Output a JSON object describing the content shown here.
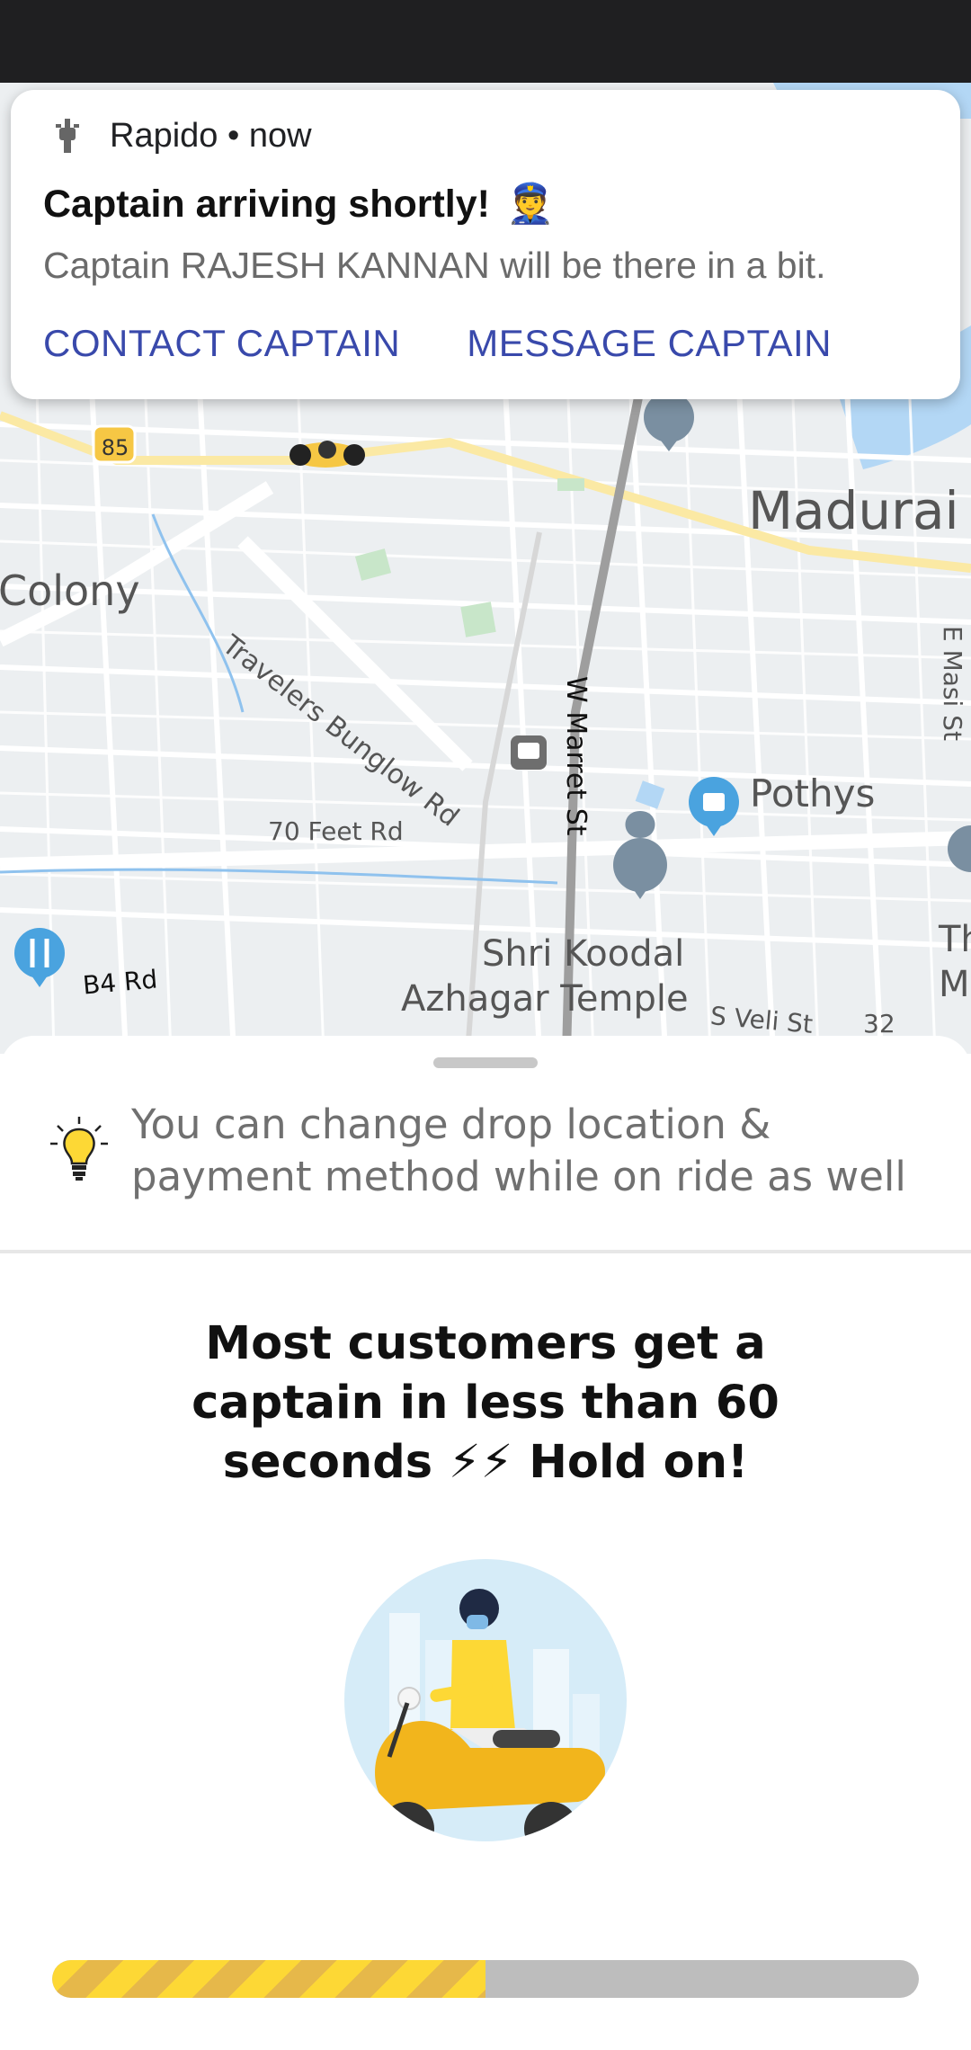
{
  "notification": {
    "app_name": "Rapido • now",
    "title": "Captain arriving shortly!",
    "title_emoji": "👮",
    "body": "Captain RAJESH KANNAN will be there in a bit.",
    "actions": [
      "CONTACT CAPTAIN",
      "MESSAGE CAPTAIN"
    ]
  },
  "map": {
    "labels": {
      "madurai": "Madurai",
      "colony": "Colony",
      "travelers": "Travelers Bunglow Rd",
      "marret": "W Marret St",
      "pothys": "Pothys",
      "seventy": "70 Feet Rd",
      "temple1": "Shri Koodal",
      "temple2": "Azhagar Temple",
      "b4": "B4 Rd",
      "veli": "S Veli St",
      "masi": "E Masi St",
      "route85": "85",
      "route32": "32",
      "th": "Th",
      "m": "M"
    }
  },
  "sheet": {
    "tip": "You can change drop location & payment method while on ride as well",
    "headline": "Most customers get a captain in less than 60 seconds ⚡⚡ Hold on!",
    "progress": 0.5
  },
  "colors": {
    "accent_blue": "#3949ab",
    "rapido_yellow": "#fdd835"
  }
}
